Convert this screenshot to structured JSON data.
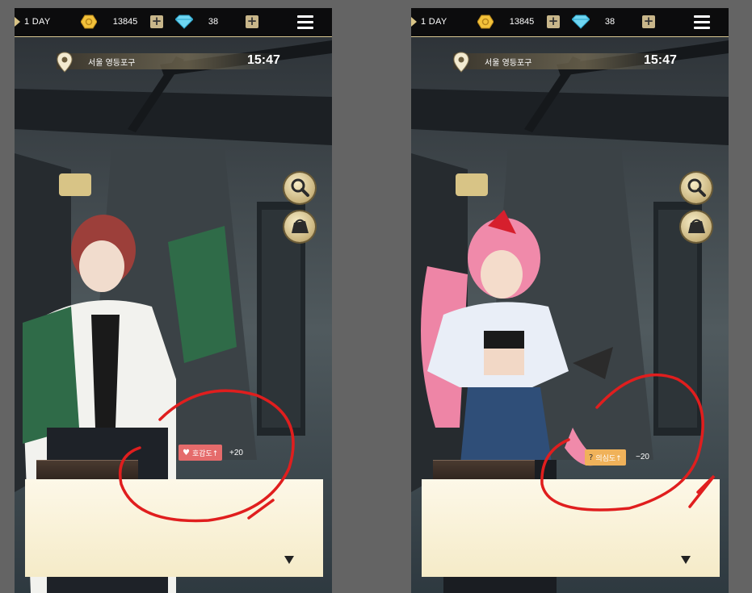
{
  "screens": [
    {
      "id": "left",
      "hud": {
        "day": "1 DAY",
        "coins": "13845",
        "gems": "38",
        "location": "서울 영등포구",
        "time": "15:47"
      },
      "stat": {
        "icon": "heart-icon",
        "symbol": "♥",
        "label": "호감도↑",
        "value": "+20",
        "color": "#e56b6b"
      }
    },
    {
      "id": "right",
      "hud": {
        "day": "1 DAY",
        "coins": "13845",
        "gems": "38",
        "location": "서울 영등포구",
        "time": "15:47"
      },
      "stat": {
        "icon": "question-icon",
        "symbol": "?",
        "label": "의심도↑",
        "value": "−20",
        "color": "#f0b25a"
      }
    }
  ],
  "colors": {
    "accent_gold": "#d9c487",
    "annotation_red": "#e01e1e",
    "dialog_bg": "#fbf3dc"
  }
}
